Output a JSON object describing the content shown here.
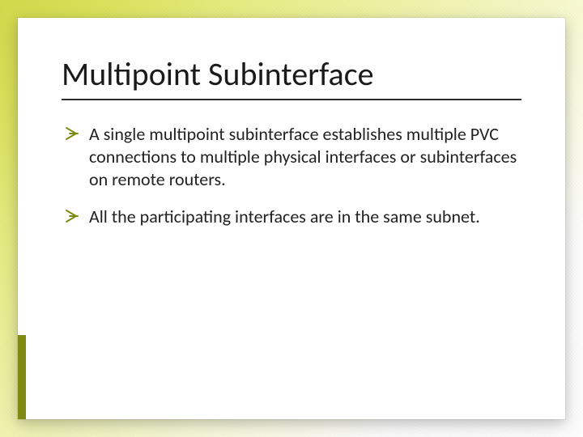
{
  "slide": {
    "title": "Multipoint Subinterface",
    "bullets": [
      "A single multipoint subinterface establishes multiple PVC connections to multiple physical interfaces or subinterfaces on remote routers.",
      "All the participating interfaces are in the same subnet."
    ],
    "accent_color": "#7e8a12"
  }
}
